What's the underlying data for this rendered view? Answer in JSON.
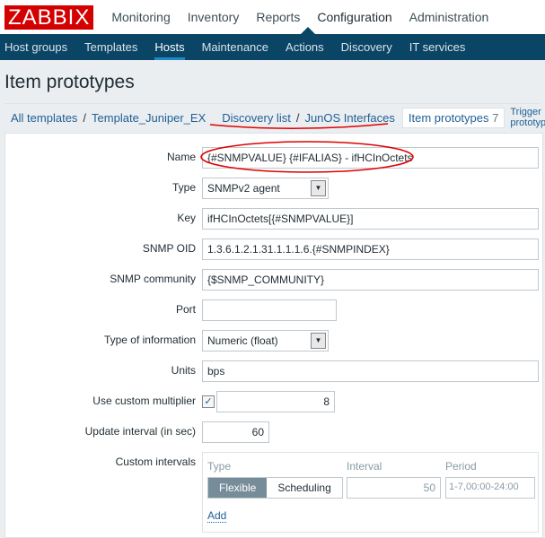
{
  "logo": "ZABBIX",
  "main_nav": [
    "Monitoring",
    "Inventory",
    "Reports",
    "Configuration",
    "Administration"
  ],
  "sub_nav": [
    "Host groups",
    "Templates",
    "Hosts",
    "Maintenance",
    "Actions",
    "Discovery",
    "IT services"
  ],
  "page_title": "Item prototypes",
  "breadcrumb": {
    "all": "All templates",
    "template": "Template_Juniper_EX",
    "discovery": "Discovery list",
    "rule": "JunOS Interfaces",
    "tab_item": "Item prototypes",
    "tab_item_count": "7",
    "tab_trigger": "Trigger prototypes"
  },
  "form": {
    "name_label": "Name",
    "name": "{#SNMPVALUE} {#IFALIAS} - ifHCInOctets",
    "type_label": "Type",
    "type": "SNMPv2 agent",
    "key_label": "Key",
    "key": "ifHCInOctets[{#SNMPVALUE}]",
    "oid_label": "SNMP OID",
    "oid": "1.3.6.1.2.1.31.1.1.1.6.{#SNMPINDEX}",
    "community_label": "SNMP community",
    "community": "{$SNMP_COMMUNITY}",
    "port_label": "Port",
    "port": "",
    "info_label": "Type of information",
    "info": "Numeric (float)",
    "units_label": "Units",
    "units": "bps",
    "mult_label": "Use custom multiplier",
    "mult_checked": true,
    "mult": "8",
    "interval_label": "Update interval (in sec)",
    "interval": "60",
    "ci_label": "Custom intervals",
    "ci": {
      "type_h": "Type",
      "interval_h": "Interval",
      "period_h": "Period",
      "flexible": "Flexible",
      "scheduling": "Scheduling",
      "interval": "50",
      "period": "1-7,00:00-24:00",
      "add": "Add"
    }
  },
  "annotation_color": "#e00000"
}
